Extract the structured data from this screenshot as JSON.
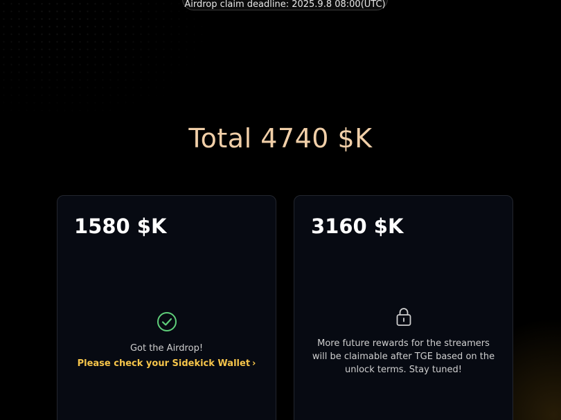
{
  "deadline": {
    "text": "Airdrop claim deadline: 2025.9.8 08:00(UTC)"
  },
  "total": {
    "text": "Total 4740 $K"
  },
  "cards": [
    {
      "amount": "1580  $K",
      "icon": "check-circle-icon",
      "status": "Got the Airdrop!",
      "link": "Please check your Sidekick Wallet",
      "link_chevron": "›"
    },
    {
      "amount": "3160 $K",
      "icon": "lock-icon",
      "status": "More future rewards for the streamers will be claimable after TGE based on the unlock terms. Stay tuned!"
    }
  ],
  "colors": {
    "accent": "#f6c54a",
    "total": "#f1cfa8",
    "success": "#5fcf7a",
    "card_bg": "#070a12"
  }
}
